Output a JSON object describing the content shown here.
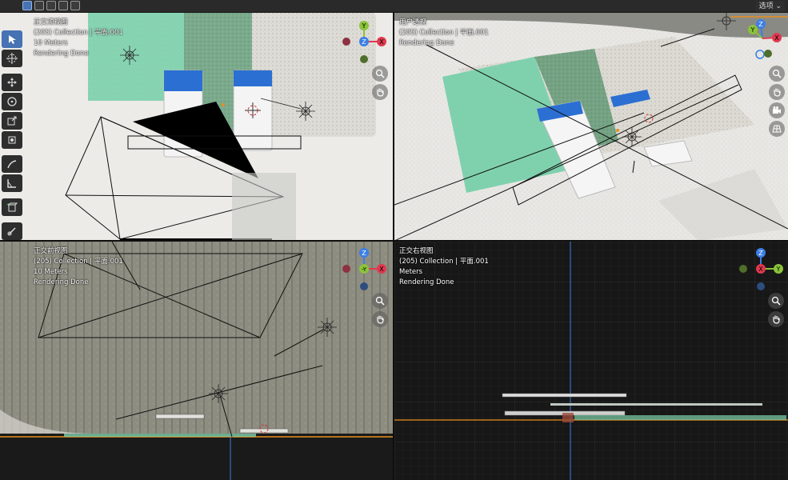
{
  "header": {
    "options_label": "选项",
    "mode_icons": [
      "box-select-icon",
      "box-select-extend-icon",
      "box-select-subtract-icon",
      "box-select-invert-icon",
      "box-select-intersect-icon"
    ]
  },
  "toolbar": {
    "tools": [
      {
        "name": "select-tool",
        "icon": "cursor-arrow-icon",
        "active": true
      },
      {
        "name": "cursor-tool",
        "icon": "3d-cursor-icon",
        "active": false
      },
      {
        "name": "move-tool",
        "icon": "move-arrows-icon",
        "active": false
      },
      {
        "name": "rotate-tool",
        "icon": "rotate-icon",
        "active": false
      },
      {
        "name": "scale-tool",
        "icon": "scale-icon",
        "active": false
      },
      {
        "name": "transform-tool",
        "icon": "transform-icon",
        "active": false
      },
      {
        "name": "annotate-tool",
        "icon": "pencil-icon",
        "active": false
      },
      {
        "name": "measure-tool",
        "icon": "ruler-icon",
        "active": false
      },
      {
        "name": "add-cube-tool",
        "icon": "add-cube-icon",
        "active": false
      },
      {
        "name": "shear-tool",
        "icon": "shear-icon",
        "active": false
      },
      {
        "name": "extra-tool",
        "icon": "curve-icon",
        "active": false
      }
    ]
  },
  "viewports": {
    "top": {
      "view_name": "正交顶视图",
      "collection": "(205) Collection | 平面.001",
      "scale": "10 Meters",
      "status": "Rendering Done"
    },
    "perspective": {
      "view_name": "用户透视",
      "collection": "(205) Collection | 平面.001",
      "status": "Rendering Done"
    },
    "front": {
      "view_name": "正交前视图",
      "collection": "(205) Collection | 平面.001",
      "scale": "10 Meters",
      "status": "Rendering Done"
    },
    "right": {
      "view_name": "正交右视图",
      "collection": "(205) Collection | 平面.001",
      "scale": "Meters",
      "status": "Rendering Done"
    }
  },
  "gizmo": {
    "top": {
      "labels": [
        "Y",
        "Z",
        "X"
      ]
    },
    "perspective": {
      "labels": [
        "Y",
        "Z",
        "X"
      ]
    },
    "front": {
      "labels": [
        "Z",
        "-Y",
        "X"
      ]
    },
    "right": {
      "labels": [
        "Z",
        "X",
        "Y"
      ]
    }
  },
  "colors": {
    "axis_x": "#e0394f",
    "axis_y": "#8ac43a",
    "axis_z": "#3b7fe4",
    "active_tool": "#4772b3",
    "floor_teal": "#7fd1ad",
    "horizon_orange": "#e8901c",
    "screen_blue": "#2b6fd3"
  }
}
